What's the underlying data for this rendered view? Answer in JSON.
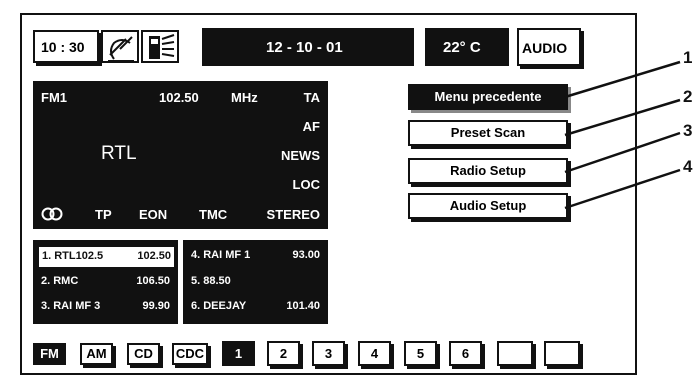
{
  "status_bar": {
    "time": "10 : 30",
    "date": "12 - 10 - 01",
    "temperature": "22° C",
    "audio_label": "AUDIO",
    "icons": [
      "satellite-dish-icon",
      "phone-icon"
    ]
  },
  "radio_display": {
    "band": "FM1",
    "frequency": "102.50",
    "unit": "MHz",
    "station": "RTL",
    "flags_right": [
      "TA",
      "AF",
      "NEWS",
      "LOC"
    ],
    "flags_bottom": [
      "TP",
      "EON",
      "TMC",
      "STEREO"
    ],
    "dolby_icon": "dolby-icon"
  },
  "menu": {
    "items": [
      {
        "label": "Menu precedente",
        "callout": "1"
      },
      {
        "label": "Preset Scan",
        "callout": "2"
      },
      {
        "label": "Radio Setup",
        "callout": "3"
      },
      {
        "label": "Audio Setup",
        "callout": "4"
      }
    ]
  },
  "presets_left": [
    {
      "name": "1. RTL102.5",
      "freq": "102.50"
    },
    {
      "name": "2. RMC",
      "freq": "106.50"
    },
    {
      "name": "3. RAI MF 3",
      "freq": "99.90"
    }
  ],
  "presets_right": [
    {
      "name": "4. RAI MF 1",
      "freq": "93.00"
    },
    {
      "name": "5. 88.50",
      "freq": ""
    },
    {
      "name": "6. DEEJAY",
      "freq": "101.40"
    }
  ],
  "bottom_bar": {
    "sources": [
      "FM",
      "AM",
      "CD",
      "CDC"
    ],
    "numbers": [
      "1",
      "2",
      "3",
      "4",
      "5",
      "6",
      "",
      ""
    ]
  }
}
